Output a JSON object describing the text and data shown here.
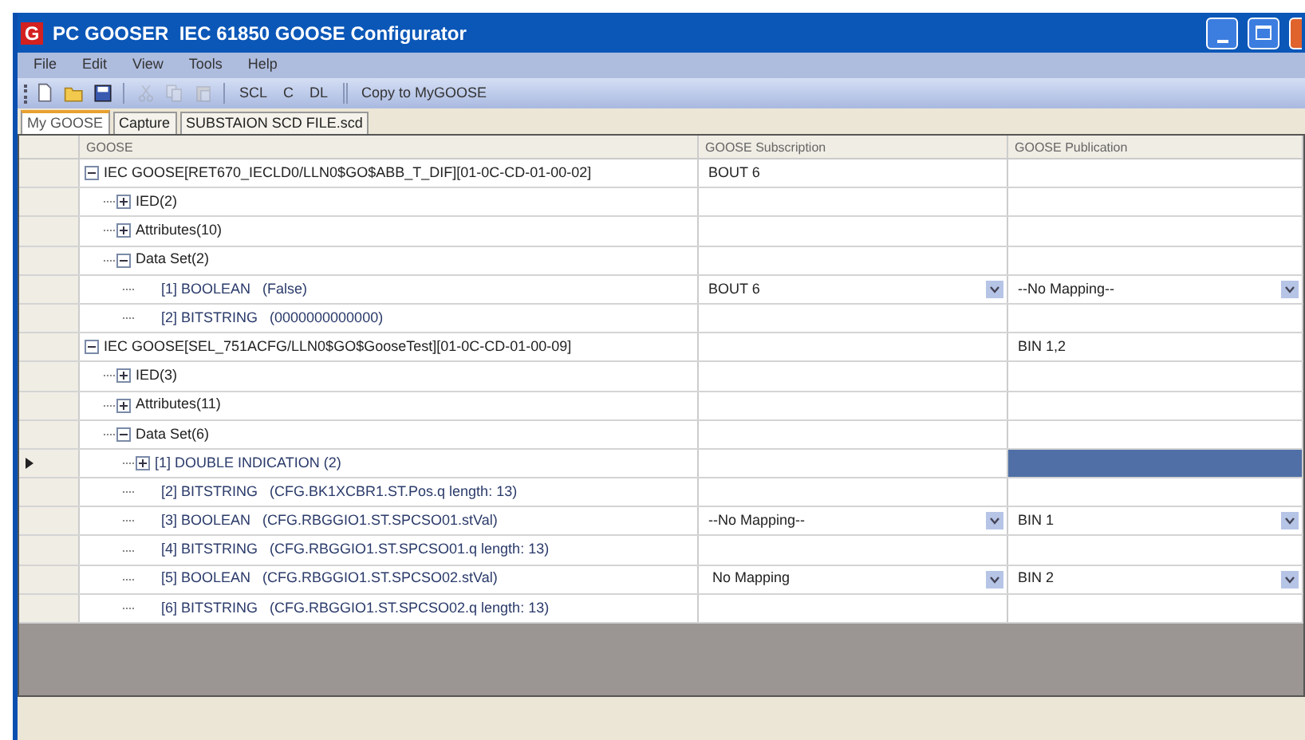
{
  "window": {
    "title": "PC GOOSER  IEC 61850 GOOSE Configurator",
    "app_letter": "G"
  },
  "menu": [
    "File",
    "Edit",
    "View",
    "Tools",
    "Help"
  ],
  "toolbar": {
    "icon_buttons": [
      {
        "disabled": false
      },
      {
        "disabled": false
      },
      {
        "disabled": false
      },
      {
        "disabled": true
      },
      {
        "disabled": true
      },
      {
        "disabled": true
      }
    ],
    "text_buttons": [
      "SCL",
      "C",
      "DL"
    ],
    "copy_button": "Copy to MyGOOSE"
  },
  "tabs": [
    {
      "label": "My GOOSE",
      "selected": true
    },
    {
      "label": "Capture",
      "selected": false
    },
    {
      "label": "SUBSTAION SCD FILE.scd",
      "selected": false
    }
  ],
  "grid": {
    "columns": [
      "GOOSE",
      "GOOSE Subscription",
      "GOOSE Publication"
    ],
    "rows": [
      {
        "label": "IEC GOOSE[RET670_IECLD0/LLN0$GO$ABB_T_DIF][01-0C-CD-01-00-02]",
        "expanded": true,
        "current": false,
        "subscription": {
          "kind": "text",
          "text": "BOUT 6"
        },
        "children": [
          {
            "label": "IED(2)",
            "expanded": false,
            "current": false
          },
          {
            "label": "Attributes(10)",
            "expanded": false,
            "current": false
          },
          {
            "label": "Data Set(2)",
            "expanded": true,
            "current": false,
            "children": [
              {
                "label": "[1] BOOLEAN   (False)",
                "current": false,
                "subscription": {
                  "kind": "dropdown",
                  "text": "BOUT 6"
                },
                "publication": {
                  "kind": "dropdown",
                  "text": "--No Mapping--"
                }
              },
              {
                "label": "[2] BITSTRING   (0000000000000)",
                "current": false
              }
            ]
          }
        ]
      },
      {
        "label": "IEC GOOSE[SEL_751ACFG/LLN0$GO$GooseTest][01-0C-CD-01-00-09]",
        "expanded": true,
        "current": false,
        "publication": {
          "kind": "text",
          "text": "BIN 1,2"
        },
        "children": [
          {
            "label": "IED(3)",
            "expanded": false,
            "current": false
          },
          {
            "label": "Attributes(11)",
            "expanded": false,
            "current": false
          },
          {
            "label": "Data Set(6)",
            "expanded": true,
            "current": false,
            "children": [
              {
                "label": "[1] DOUBLE INDICATION (2)",
                "expanded": false,
                "current": true,
                "publication": {
                  "kind": "selected"
                }
              },
              {
                "label": "[2] BITSTRING   (CFG.BK1XCBR1.ST.Pos.q length: 13)",
                "current": false
              },
              {
                "label": "[3] BOOLEAN   (CFG.RBGGIO1.ST.SPCSO01.stVal)",
                "current": false,
                "subscription": {
                  "kind": "dropdown",
                  "text": "--No Mapping--"
                },
                "publication": {
                  "kind": "dropdown",
                  "text": "BIN 1"
                }
              },
              {
                "label": "[4] BITSTRING   (CFG.RBGGIO1.ST.SPCSO01.q length: 13)",
                "current": false
              },
              {
                "label": "[5] BOOLEAN   (CFG.RBGGIO1.ST.SPCSO02.stVal)",
                "current": false,
                "subscription": {
                  "kind": "dropdown",
                  "text": " No Mapping"
                },
                "publication": {
                  "kind": "dropdown",
                  "text": "BIN 2"
                }
              },
              {
                "label": "[6] BITSTRING   (CFG.RBGGIO1.ST.SPCSO02.q length: 13)",
                "current": false
              }
            ]
          }
        ]
      }
    ]
  }
}
